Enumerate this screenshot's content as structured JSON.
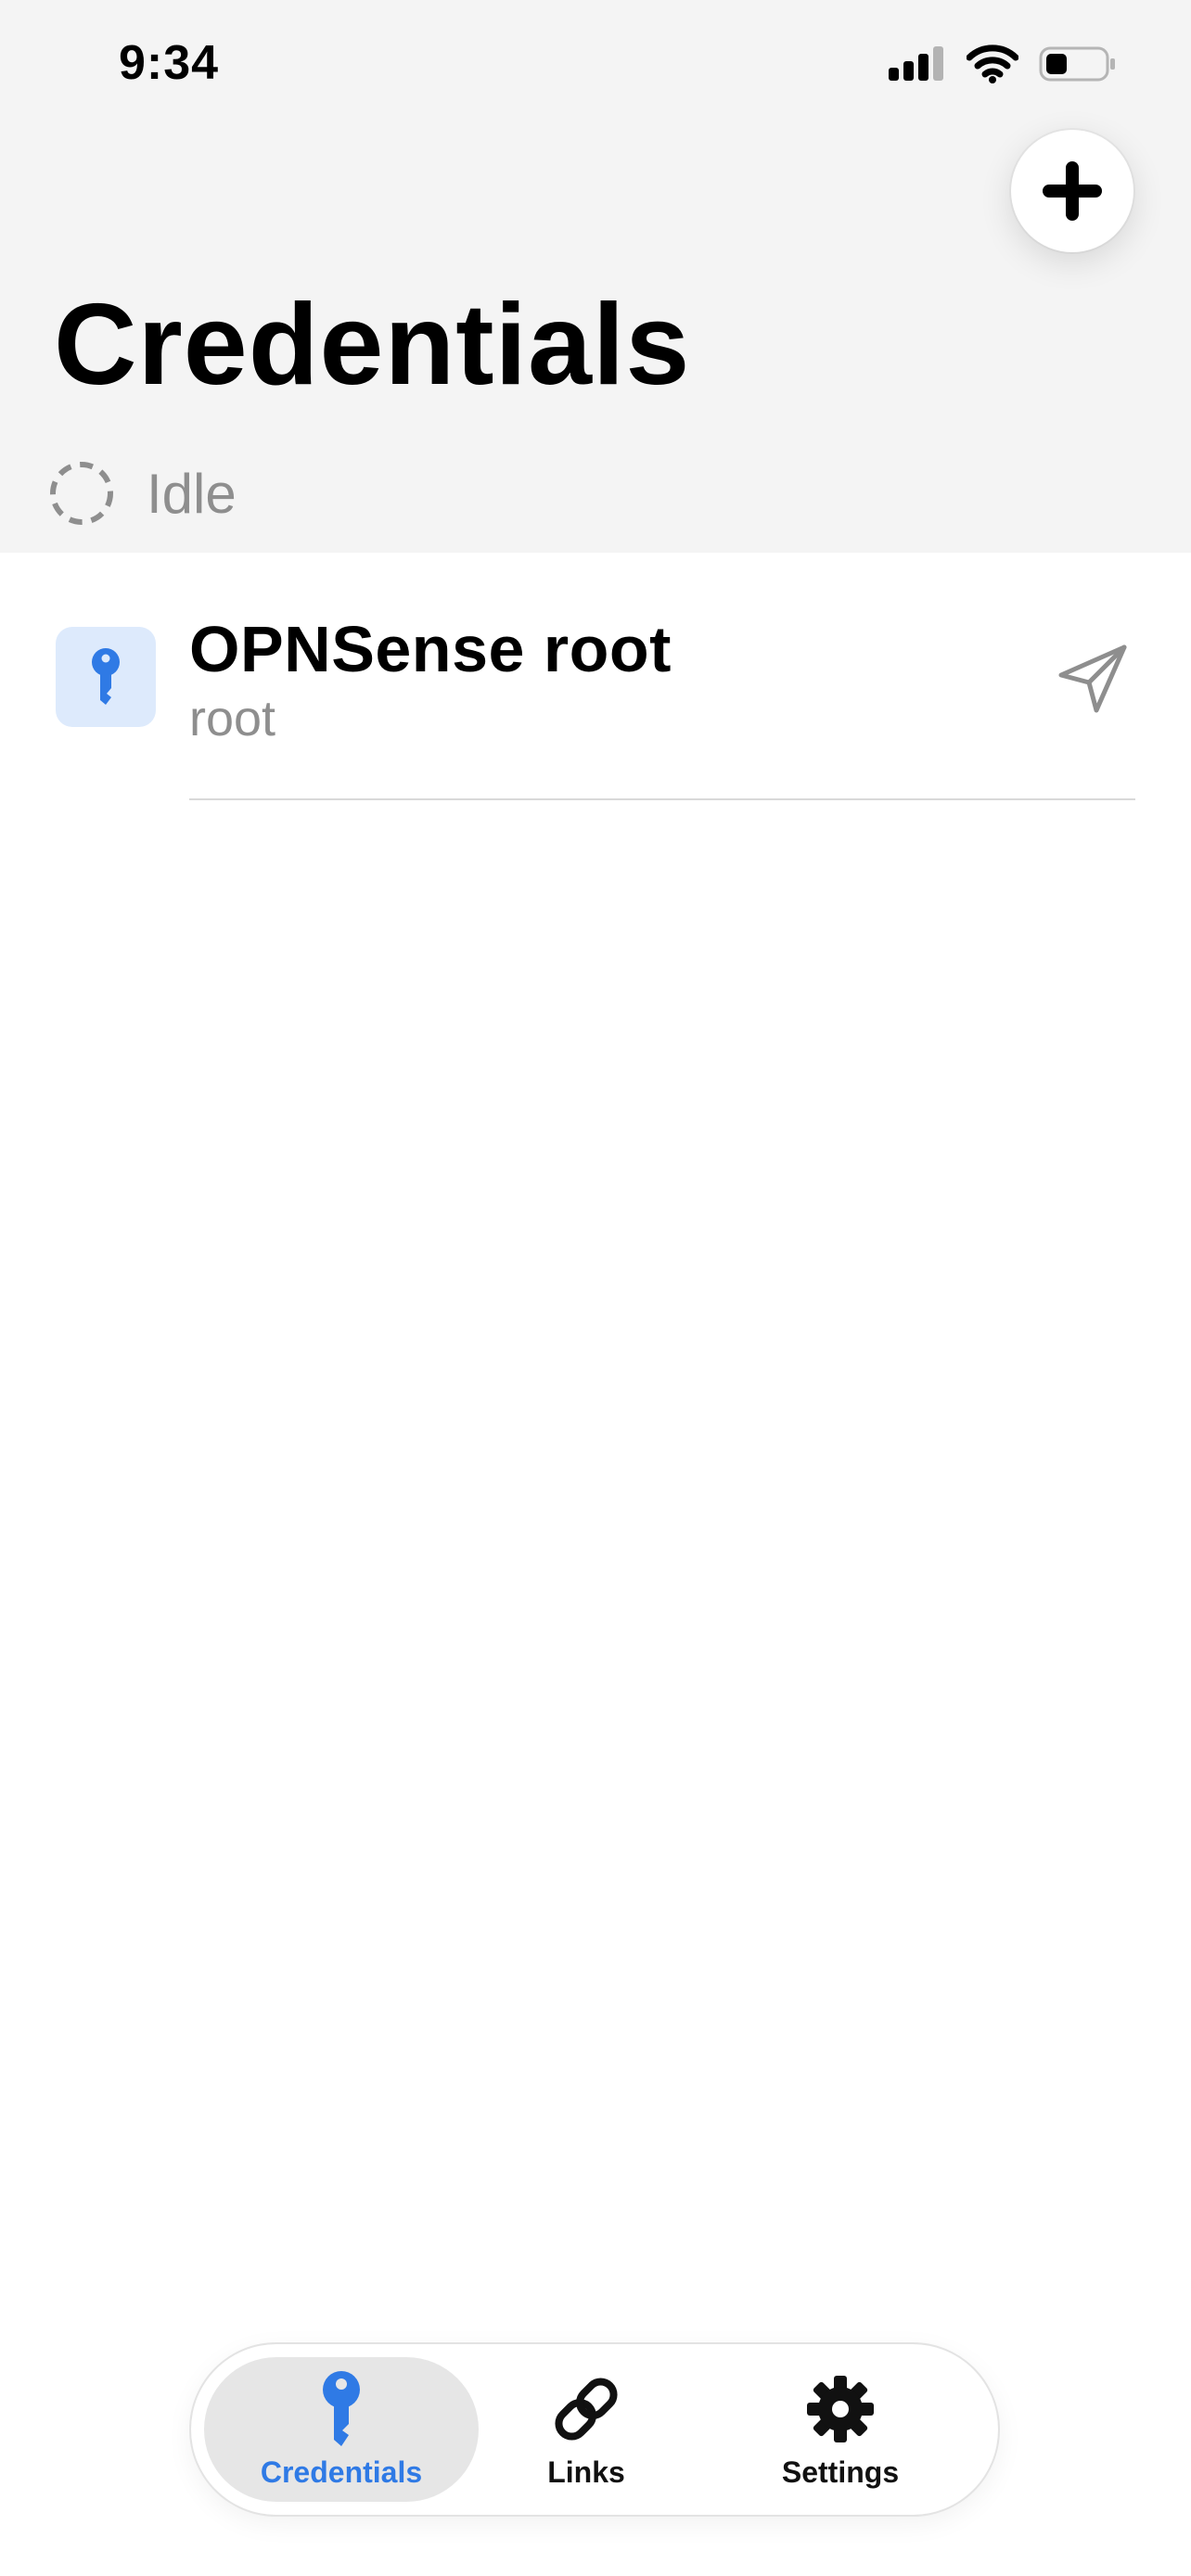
{
  "status_bar": {
    "time": "9:34",
    "icons": [
      "cellular-signal-icon",
      "wifi-icon",
      "battery-icon"
    ]
  },
  "header": {
    "add_button_icon": "plus-icon",
    "title": "Credentials",
    "sync_status": {
      "icon": "dashed-circle-icon",
      "label": "Idle"
    },
    "background_color": "#f4f4f4"
  },
  "credentials": [
    {
      "icon": "key-icon",
      "title": "OPNSense root",
      "username": "root",
      "action_icon": "paper-plane-send-icon"
    }
  ],
  "tab_bar": {
    "active_color": "#2f7ae5",
    "tabs": [
      {
        "label": "Credentials",
        "icon": "key-icon",
        "active": true
      },
      {
        "label": "Links",
        "icon": "link-icon",
        "active": false
      },
      {
        "label": "Settings",
        "icon": "gear-icon",
        "active": false
      }
    ]
  }
}
